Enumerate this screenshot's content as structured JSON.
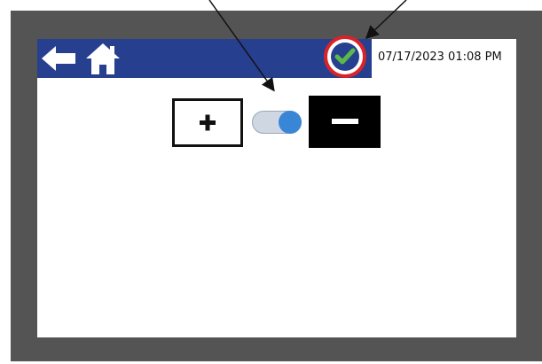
{
  "header": {
    "datetime": "07/17/2023 01:08 PM",
    "back_icon": "back-arrow-icon",
    "home_icon": "home-icon",
    "status_icon": "checkmark-icon"
  },
  "controls": {
    "increase_icon": "plus-icon",
    "decrease_icon": "minus-icon",
    "toggle_state": "on"
  },
  "colors": {
    "header_bar": "#273f8f",
    "status_ring": "#d8232a",
    "check": "#5bb947",
    "toggle_knob": "#3a86d6",
    "bezel": "#545454"
  }
}
